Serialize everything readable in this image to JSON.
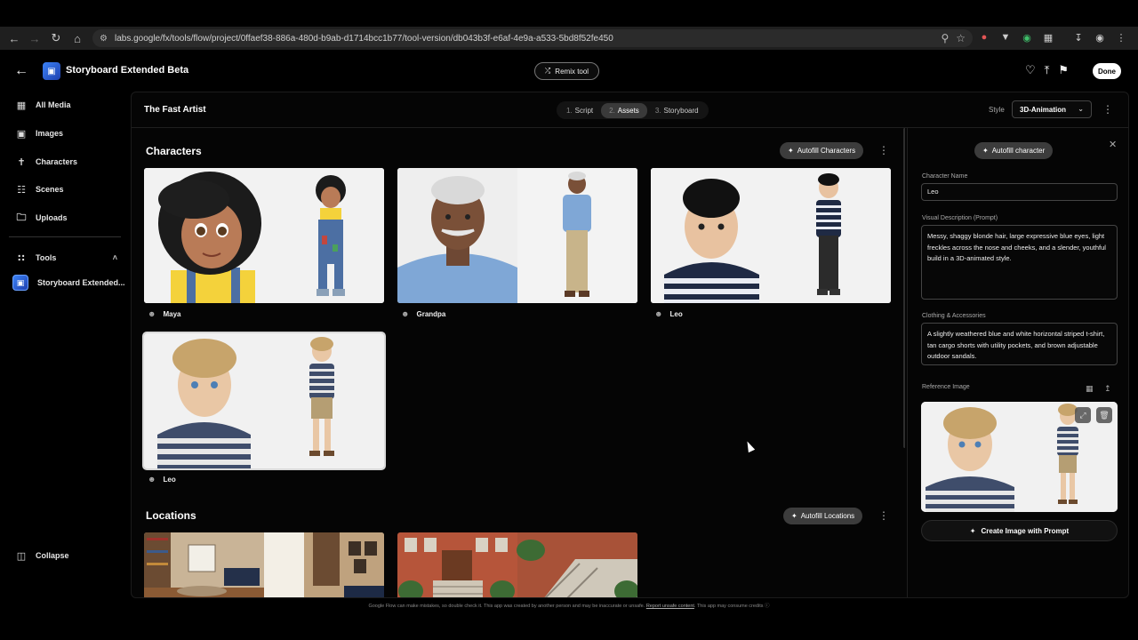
{
  "browser": {
    "url": "labs.google/fx/tools/flow/project/0ffaef38-886a-480d-b9ab-d1714bcc1b77/tool-version/db043b3f-e6af-4e9a-a533-5bd8f52fe450"
  },
  "header": {
    "app_title": "Storyboard Extended Beta",
    "remix_label": "Remix tool",
    "done_label": "Done"
  },
  "sidebar": {
    "items": [
      {
        "label": "All Media",
        "icon": "grid-icon"
      },
      {
        "label": "Images",
        "icon": "image-icon"
      },
      {
        "label": "Characters",
        "icon": "person-icon"
      },
      {
        "label": "Scenes",
        "icon": "film-icon"
      },
      {
        "label": "Uploads",
        "icon": "upload-folder-icon"
      }
    ],
    "tools_label": "Tools",
    "tool_item_label": "Storyboard Extended...",
    "collapse_label": "Collapse"
  },
  "main": {
    "project_title": "The Fast Artist",
    "steps": [
      {
        "num": "1.",
        "label": "Script",
        "active": false
      },
      {
        "num": "2.",
        "label": "Assets",
        "active": true
      },
      {
        "num": "3.",
        "label": "Storyboard",
        "active": false
      }
    ],
    "style_label": "Style",
    "style_value": "3D-Animation"
  },
  "characters": {
    "title": "Characters",
    "autofill_label": "Autofill Characters",
    "items": [
      {
        "name": "Maya"
      },
      {
        "name": "Grandpa"
      },
      {
        "name": "Leo"
      },
      {
        "name": "Leo"
      }
    ]
  },
  "locations": {
    "title": "Locations",
    "autofill_label": "Autofill Locations"
  },
  "panel": {
    "autofill_label": "Autofill character",
    "name_label": "Character Name",
    "name_value": "Leo",
    "desc_label": "Visual Description (Prompt)",
    "desc_value": "Messy, shaggy blonde hair, large expressive blue eyes, light freckles across the nose and cheeks, and a slender, youthful build in a 3D-animated style.",
    "clothing_label": "Clothing & Accessories",
    "clothing_value": "A slightly weathered blue and white horizontal striped t-shirt, tan cargo shorts with utility pockets, and brown adjustable outdoor sandals.",
    "ref_label": "Reference Image",
    "create_label": "Create Image with Prompt"
  },
  "footer": {
    "text_a": "Google Flow can make mistakes, so double check it. This app was created by another person and may be inaccurate or unsafe.",
    "link": "Report unsafe content",
    "text_b": "This app may consume credits"
  },
  "colors": {
    "accent": "#3b82f6",
    "background": "#000000",
    "chip": "#3c3c3c"
  }
}
